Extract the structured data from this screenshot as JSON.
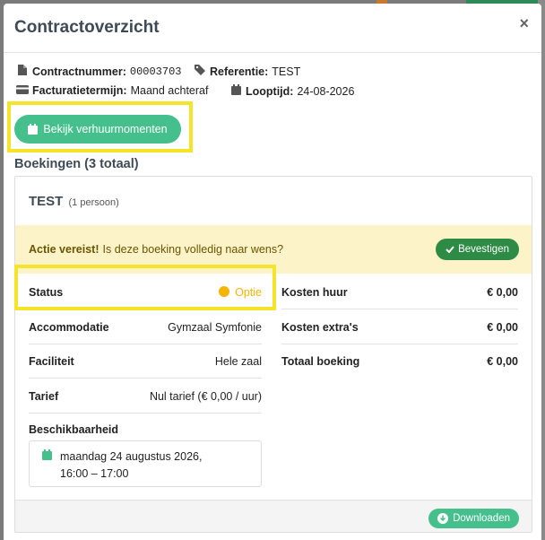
{
  "modal": {
    "title": "Contractoverzicht",
    "close_label": "×"
  },
  "contract": {
    "number_label": "Contractnummer:",
    "number_value": "00003703",
    "reference_label": "Referentie:",
    "reference_value": "TEST",
    "billing_label": "Facturatietermijn:",
    "billing_value": "Maand achteraf",
    "duration_label": "Looptijd:",
    "duration_value": "24-08-2026"
  },
  "view_moments_button": "Bekijk verhuurmomenten",
  "bookings": {
    "title": "Boekingen (3 totaal)",
    "card": {
      "name": "TEST",
      "persons": "(1 persoon)",
      "alert_bold": "Actie vereist!",
      "alert_text": "Is deze boeking volledig naar wens?",
      "confirm_button": "Bevestigen",
      "left_rows": [
        {
          "label": "Status",
          "value": "Optie"
        },
        {
          "label": "Accommodatie",
          "value": "Gymzaal Symfonie"
        },
        {
          "label": "Faciliteit",
          "value": "Hele zaal"
        },
        {
          "label": "Tarief",
          "value": "Nul tarief (€ 0,00 / uur)"
        }
      ],
      "right_rows": [
        {
          "label": "Kosten huur",
          "value": "€ 0,00"
        },
        {
          "label": "Kosten extra's",
          "value": "€ 0,00"
        },
        {
          "label": "Totaal boeking",
          "value": "€ 0,00"
        }
      ],
      "availability_label": "Beschikbaarheid",
      "availability_date": "maandag 24 augustus 2026,",
      "availability_time": "16:00 – 17:00",
      "download_button": "Downloaden"
    }
  },
  "colors": {
    "accent_green": "#45c08c",
    "confirm_green": "#2e8b45",
    "status_option": "#f5b400",
    "highlight_yellow": "#f5e42a",
    "alert_bg": "#fdf3c9"
  },
  "icons": [
    "file-icon",
    "tag-icon",
    "credit-card-icon",
    "calendar-icon",
    "check-icon",
    "download-icon",
    "close-icon"
  ]
}
